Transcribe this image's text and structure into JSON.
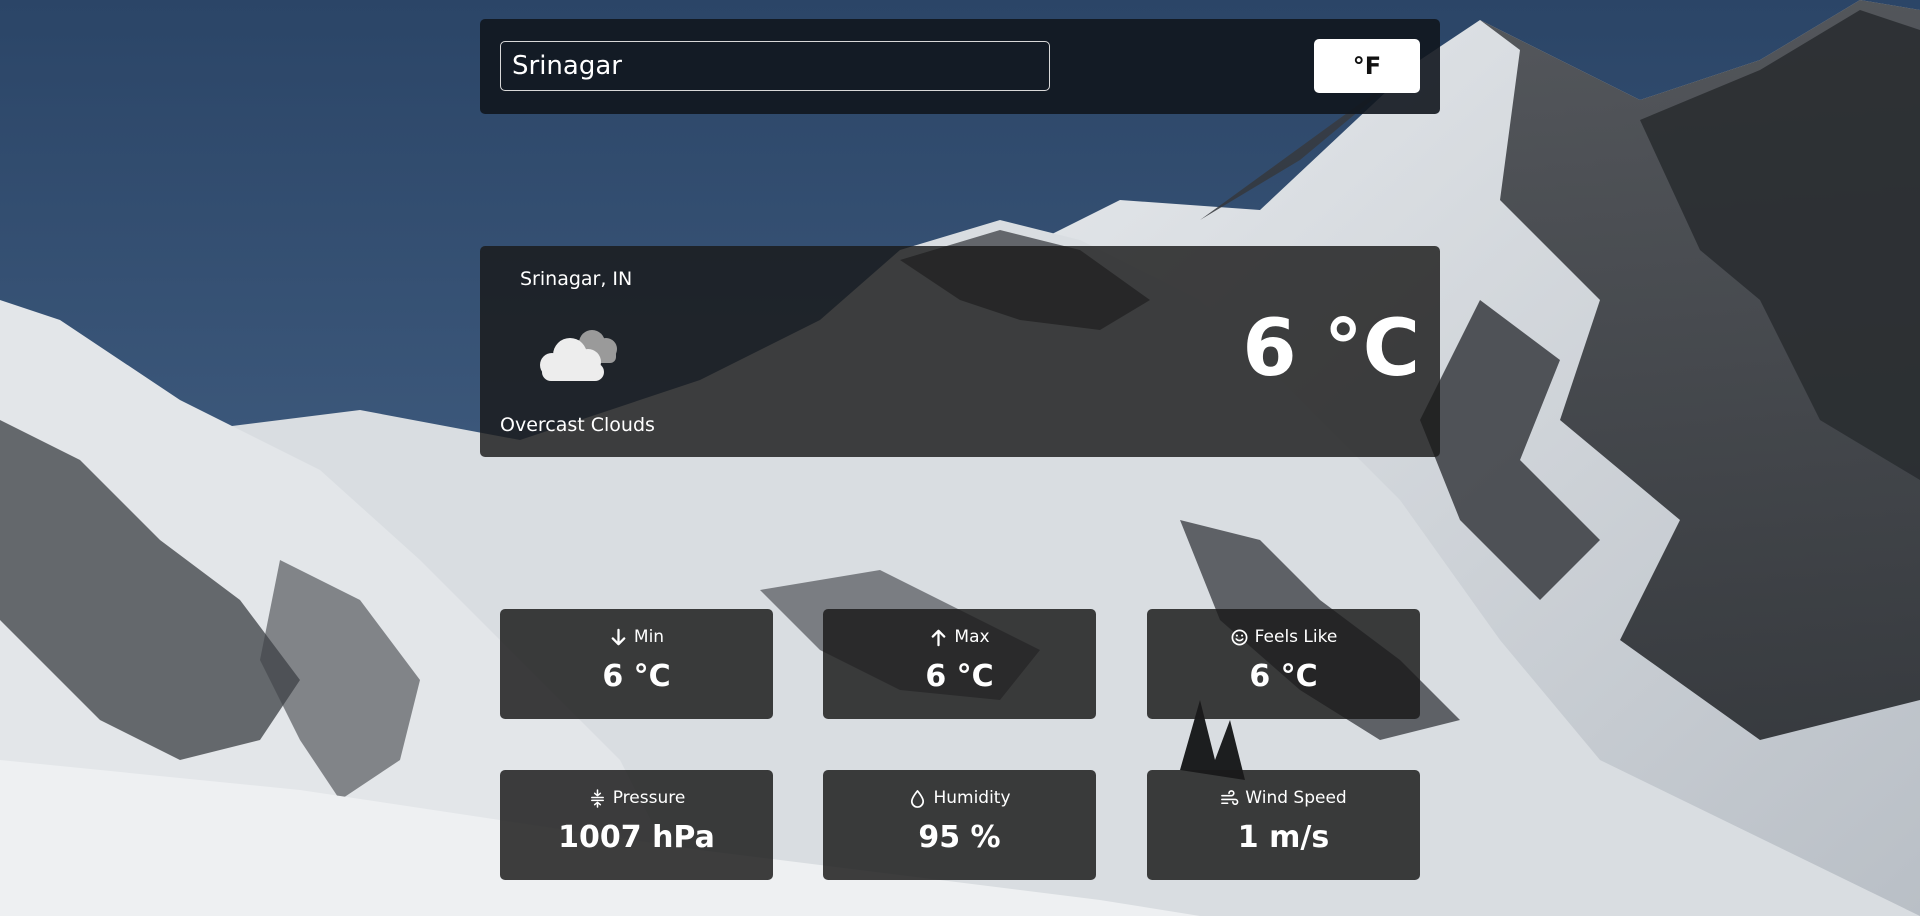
{
  "search": {
    "value": "Srinagar",
    "placeholder": ""
  },
  "unit_toggle": {
    "label": "°F"
  },
  "current": {
    "location": "Srinagar, IN",
    "condition": "Overcast Clouds",
    "temperature": "6 °C",
    "icon": "overcast-clouds-icon"
  },
  "stats": [
    {
      "label": "Min",
      "value": "6 °C",
      "icon": "arrow-down-icon"
    },
    {
      "label": "Max",
      "value": "6 °C",
      "icon": "arrow-up-icon"
    },
    {
      "label": "Feels Like",
      "value": "6 °C",
      "icon": "smile-icon"
    },
    {
      "label": "Pressure",
      "value": "1007 hPa",
      "icon": "pressure-icon"
    },
    {
      "label": "Humidity",
      "value": "95 %",
      "icon": "droplet-icon"
    },
    {
      "label": "Wind Speed",
      "value": "1 m/s",
      "icon": "wind-icon"
    }
  ],
  "colors": {
    "sky": "#3a5577",
    "card_background": "#1a1a1a",
    "text": "#ffffff"
  }
}
